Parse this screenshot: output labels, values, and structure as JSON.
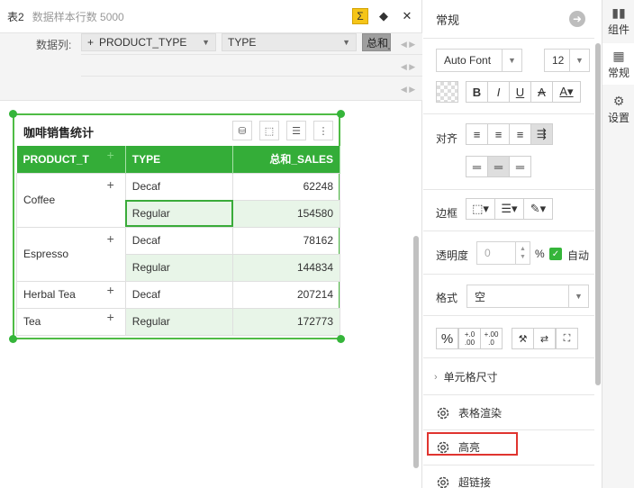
{
  "header": {
    "table_name": "表2",
    "sample_count": "数据样本行数 5000"
  },
  "data_columns": {
    "label": "数据列:",
    "chips": [
      {
        "prefix": "+",
        "text": "PRODUCT_TYPE"
      },
      {
        "prefix": "",
        "text": "TYPE"
      },
      {
        "prefix": "",
        "text": "总和_"
      }
    ]
  },
  "widget": {
    "title": "咖啡销售统计",
    "columns": [
      "PRODUCT_T",
      "TYPE",
      "总和_SALES"
    ],
    "rows": [
      {
        "product": "Coffee",
        "type": "Decaf",
        "sales": "62248"
      },
      {
        "product": "",
        "type": "Regular",
        "sales": "154580"
      },
      {
        "product": "Espresso",
        "type": "Decaf",
        "sales": "78162"
      },
      {
        "product": "",
        "type": "Regular",
        "sales": "144834"
      },
      {
        "product": "Herbal Tea",
        "type": "Decaf",
        "sales": "207214"
      },
      {
        "product": "Tea",
        "type": "Regular",
        "sales": "172773"
      }
    ],
    "plus": "+"
  },
  "props": {
    "title": "常规",
    "font_family": "Auto Font",
    "font_size": "12",
    "align_label": "对齐",
    "border_label": "边框",
    "opacity_label": "透明度",
    "opacity_value": "0",
    "percent": "%",
    "auto_label": "自动",
    "format_label": "格式",
    "format_value": "空",
    "cell_size_label": "单元格尺寸",
    "render_label": "表格渲染",
    "highlight_label": "高亮",
    "hyperlink_label": "超链接",
    "fmt_percent": "%",
    "decimal_add_top": "+.0",
    "decimal_add_bottom": ".00",
    "decimal_remove_top": "+.00",
    "decimal_remove_bottom": ".0"
  },
  "side_tabs": [
    {
      "label": "组件",
      "icon": "bar-chart-icon"
    },
    {
      "label": "常规",
      "icon": "grid-icon"
    },
    {
      "label": "设置",
      "icon": "gear-icon"
    }
  ],
  "colors": {
    "accent_green": "#34ad38",
    "highlight_red": "#e0342f",
    "sigma_yellow": "#f5c518"
  }
}
